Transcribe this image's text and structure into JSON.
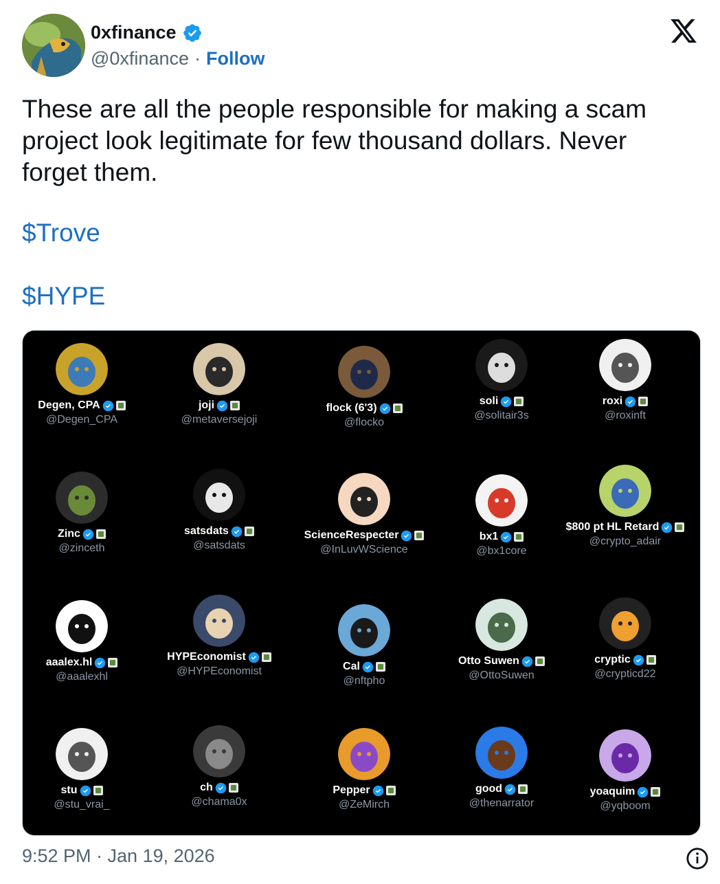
{
  "author": {
    "display_name": "0xfinance",
    "handle": "@0xfinance",
    "separator": "·",
    "follow_label": "Follow",
    "verified": true
  },
  "tweet": {
    "text": "These are all the people responsible for making a scam project look legitimate for few thousand dollars. Never forget them.",
    "cashtag_1": "$Trove",
    "cashtag_2": "$HYPE",
    "timestamp": "9:52 PM · Jan 19, 2026"
  },
  "colors": {
    "link": "#1d6fc2",
    "verified_blue": "#1d9bf0",
    "muted_text": "#536471"
  },
  "icons": {
    "logo": "x-logo-icon",
    "verified": "verified-badge-icon",
    "info": "info-icon"
  },
  "media": {
    "people": [
      {
        "name": "Degen, CPA",
        "handle": "@Degen_CPA"
      },
      {
        "name": "joji",
        "handle": "@metaversejoji"
      },
      {
        "name": "flock (6'3)",
        "handle": "@flocko"
      },
      {
        "name": "soli",
        "handle": "@solitair3s"
      },
      {
        "name": "roxi",
        "handle": "@roxinft"
      },
      {
        "name": "Zinc",
        "handle": "@zinceth"
      },
      {
        "name": "satsdats",
        "handle": "@satsdats"
      },
      {
        "name": "ScienceRespecter",
        "handle": "@InLuvWScience"
      },
      {
        "name": "bx1",
        "handle": "@bx1core"
      },
      {
        "name": "$800 pt HL Retard",
        "handle": "@crypto_adair"
      },
      {
        "name": "aaalex.hl",
        "handle": "@aaalexhl"
      },
      {
        "name": "HYPEconomist",
        "handle": "@HYPEconomist"
      },
      {
        "name": "Cal",
        "handle": "@nftpho"
      },
      {
        "name": "Otto Suwen",
        "handle": "@OttoSuwen"
      },
      {
        "name": "cryptic",
        "handle": "@crypticd22"
      },
      {
        "name": "stu",
        "handle": "@stu_vrai_"
      },
      {
        "name": "ch",
        "handle": "@chama0x"
      },
      {
        "name": "Pepper",
        "handle": "@ZeMirch"
      },
      {
        "name": "good",
        "handle": "@thenarrator"
      },
      {
        "name": "yoaquim",
        "handle": "@yqboom"
      }
    ]
  }
}
